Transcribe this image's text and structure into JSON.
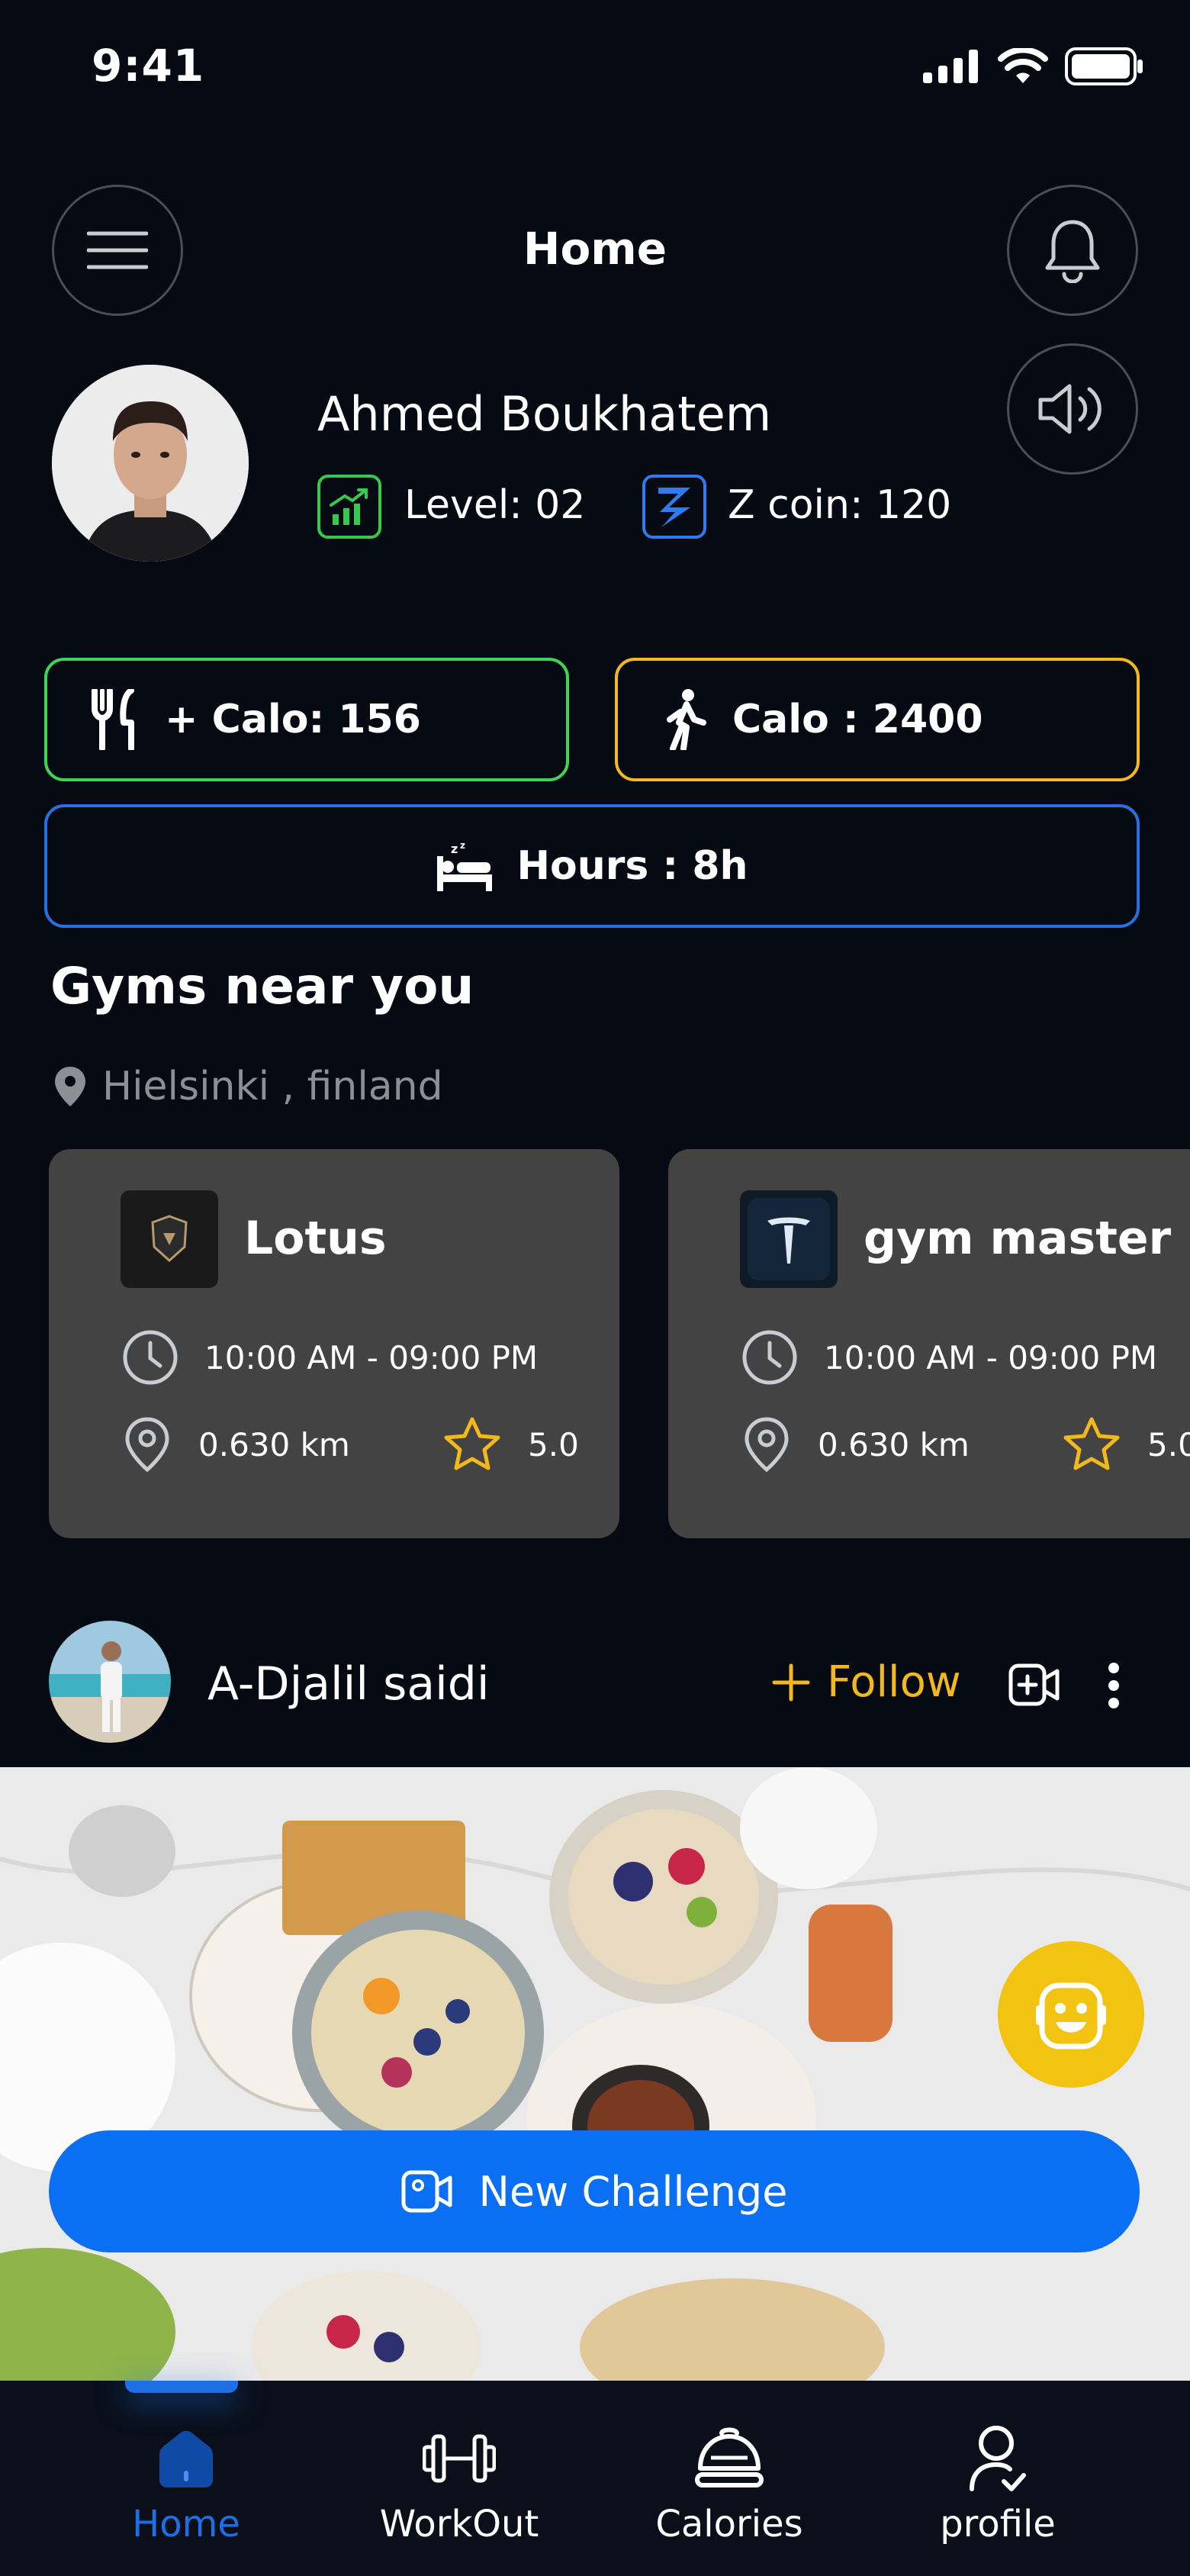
{
  "status_bar": {
    "time": "9:41"
  },
  "header": {
    "title": "Home"
  },
  "user": {
    "name": "Ahmed Boukhatem",
    "level": "Level: 02",
    "coins": "Z coin: 120"
  },
  "stats": {
    "calo_in": "+ Calo: 156",
    "calo_out": "Calo : 2400",
    "sleep": "Hours : 8h"
  },
  "gyms": {
    "section_title": "Gyms near you",
    "location": "Hielsinki , finland",
    "items": [
      {
        "name": "Lotus",
        "hours": "10:00 AM - 09:00 PM",
        "distance": "0.630 km",
        "rating": "5.0"
      },
      {
        "name": "gym master",
        "hours": "10:00 AM - 09:00 PM",
        "distance": "0.630 km",
        "rating": "5.0"
      }
    ]
  },
  "post": {
    "user": "A-Djalil saidi",
    "follow_label": "Follow"
  },
  "challenge_button": "New Challenge",
  "nav": {
    "items": [
      {
        "label": "Home"
      },
      {
        "label": "WorkOut"
      },
      {
        "label": "Calories"
      },
      {
        "label": "profile"
      }
    ]
  },
  "colors": {
    "background": "#060a12",
    "green": "#3fd35a",
    "yellow": "#f2b81c",
    "blue": "#2a6fe0",
    "primary": "#0a6ff2",
    "card": "#434343"
  }
}
